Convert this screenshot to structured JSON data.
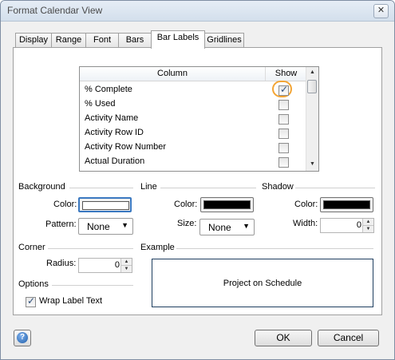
{
  "window": {
    "title": "Format Calendar View",
    "close_glyph": "✕"
  },
  "tabs": [
    {
      "label": "Display"
    },
    {
      "label": "Range"
    },
    {
      "label": "Font"
    },
    {
      "label": "Bars"
    },
    {
      "label": "Bar Labels",
      "active": true
    },
    {
      "label": "Gridlines"
    }
  ],
  "grid": {
    "columns": {
      "column": "Column",
      "show": "Show"
    },
    "rows": [
      {
        "label": "% Complete",
        "checked": true
      },
      {
        "label": "% Used",
        "checked": false
      },
      {
        "label": "Activity Name",
        "checked": false
      },
      {
        "label": "Activity Row ID",
        "checked": false
      },
      {
        "label": "Activity Row Number",
        "checked": false
      },
      {
        "label": "Actual Duration",
        "checked": false
      }
    ]
  },
  "background": {
    "heading": "Background",
    "color_label": "Color:",
    "color_value": "#ffffff",
    "pattern_label": "Pattern:",
    "pattern_value": "None"
  },
  "line": {
    "heading": "Line",
    "color_label": "Color:",
    "color_value": "#000000",
    "size_label": "Size:",
    "size_value": "None"
  },
  "shadow": {
    "heading": "Shadow",
    "color_label": "Color:",
    "color_value": "#000000",
    "width_label": "Width:",
    "width_value": "0"
  },
  "corner": {
    "heading": "Corner",
    "radius_label": "Radius:",
    "radius_value": "0"
  },
  "example": {
    "heading": "Example",
    "text": "Project on Schedule"
  },
  "options": {
    "heading": "Options",
    "wrap_label": "Wrap Label Text",
    "wrap_checked": true
  },
  "footer": {
    "ok_label": "OK",
    "cancel_label": "Cancel",
    "help_glyph": "?"
  },
  "colors": {
    "accent": "#f3a535",
    "focus": "#3a78c0"
  }
}
